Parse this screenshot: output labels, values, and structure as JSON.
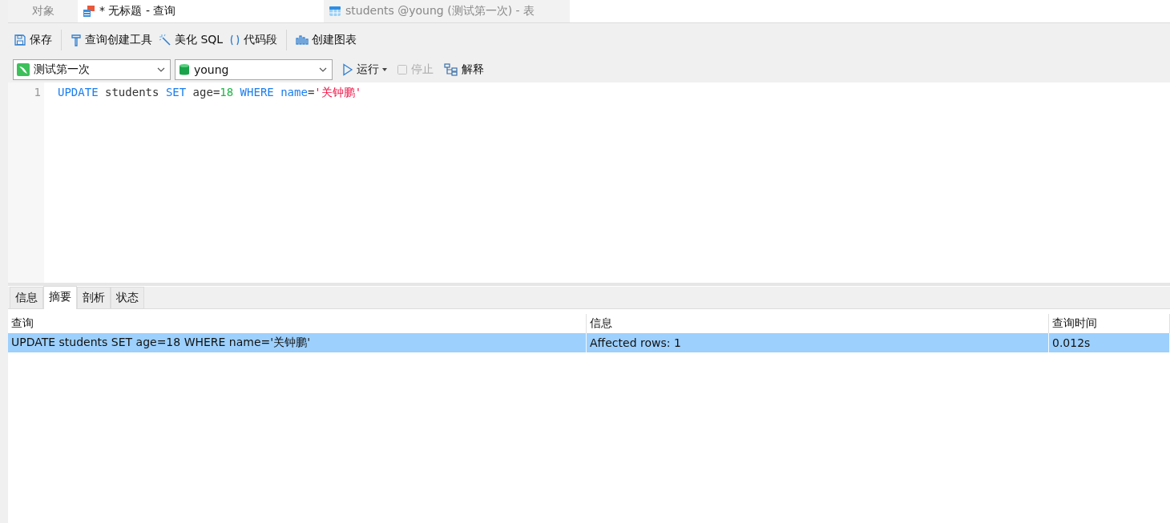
{
  "tabs": [
    {
      "label": "对象",
      "selected": false,
      "kind": "plain"
    },
    {
      "label": "* 无标题 - 查询",
      "selected": true,
      "kind": "query"
    },
    {
      "label": "students @young (测试第一次) - 表",
      "selected": false,
      "kind": "table"
    }
  ],
  "toolbar": [
    [
      {
        "label": "保存",
        "kind": "save"
      }
    ],
    [
      {
        "label": "查询创建工具",
        "kind": "builder"
      },
      {
        "label": "美化 SQL",
        "kind": "beautify"
      },
      {
        "label": "代码段",
        "kind": "snippet"
      }
    ],
    [
      {
        "label": "创建图表",
        "kind": "chart"
      }
    ]
  ],
  "selectors": [
    {
      "value": "测试第一次",
      "kind": "connection"
    },
    {
      "value": "young",
      "kind": "database"
    }
  ],
  "actions": [
    {
      "label": "运行",
      "kind": "run",
      "disabled": false,
      "dropdown": true
    },
    {
      "label": "停止",
      "kind": "stop",
      "disabled": true,
      "dropdown": false
    },
    {
      "label": "解释",
      "kind": "explain",
      "disabled": false,
      "dropdown": false
    }
  ],
  "editor": {
    "lines": [
      {
        "number": "1",
        "tokens": [
          {
            "text": "UPDATE",
            "kind": "keyword"
          },
          {
            "text": " students ",
            "kind": "plain"
          },
          {
            "text": "SET",
            "kind": "keyword"
          },
          {
            "text": " age=",
            "kind": "plain"
          },
          {
            "text": "18",
            "kind": "number"
          },
          {
            "text": " WHERE",
            "kind": "keyword"
          },
          {
            "text": " name",
            "kind": "keyword"
          },
          {
            "text": "=",
            "kind": "plain"
          },
          {
            "text": "'关钟鹏'",
            "kind": "string"
          }
        ]
      }
    ]
  },
  "result_tabs": [
    {
      "label": "信息",
      "selected": false
    },
    {
      "label": "摘要",
      "selected": true
    },
    {
      "label": "剖析",
      "selected": false
    },
    {
      "label": "状态",
      "selected": false
    }
  ],
  "table": {
    "columns": [
      "查询",
      "信息",
      "查询时间"
    ],
    "rows": [
      {
        "cells": [
          "UPDATE students SET age=18 WHERE name='关钟鹏'",
          "Affected rows: 1",
          "0.012s"
        ],
        "selected": true
      }
    ]
  }
}
